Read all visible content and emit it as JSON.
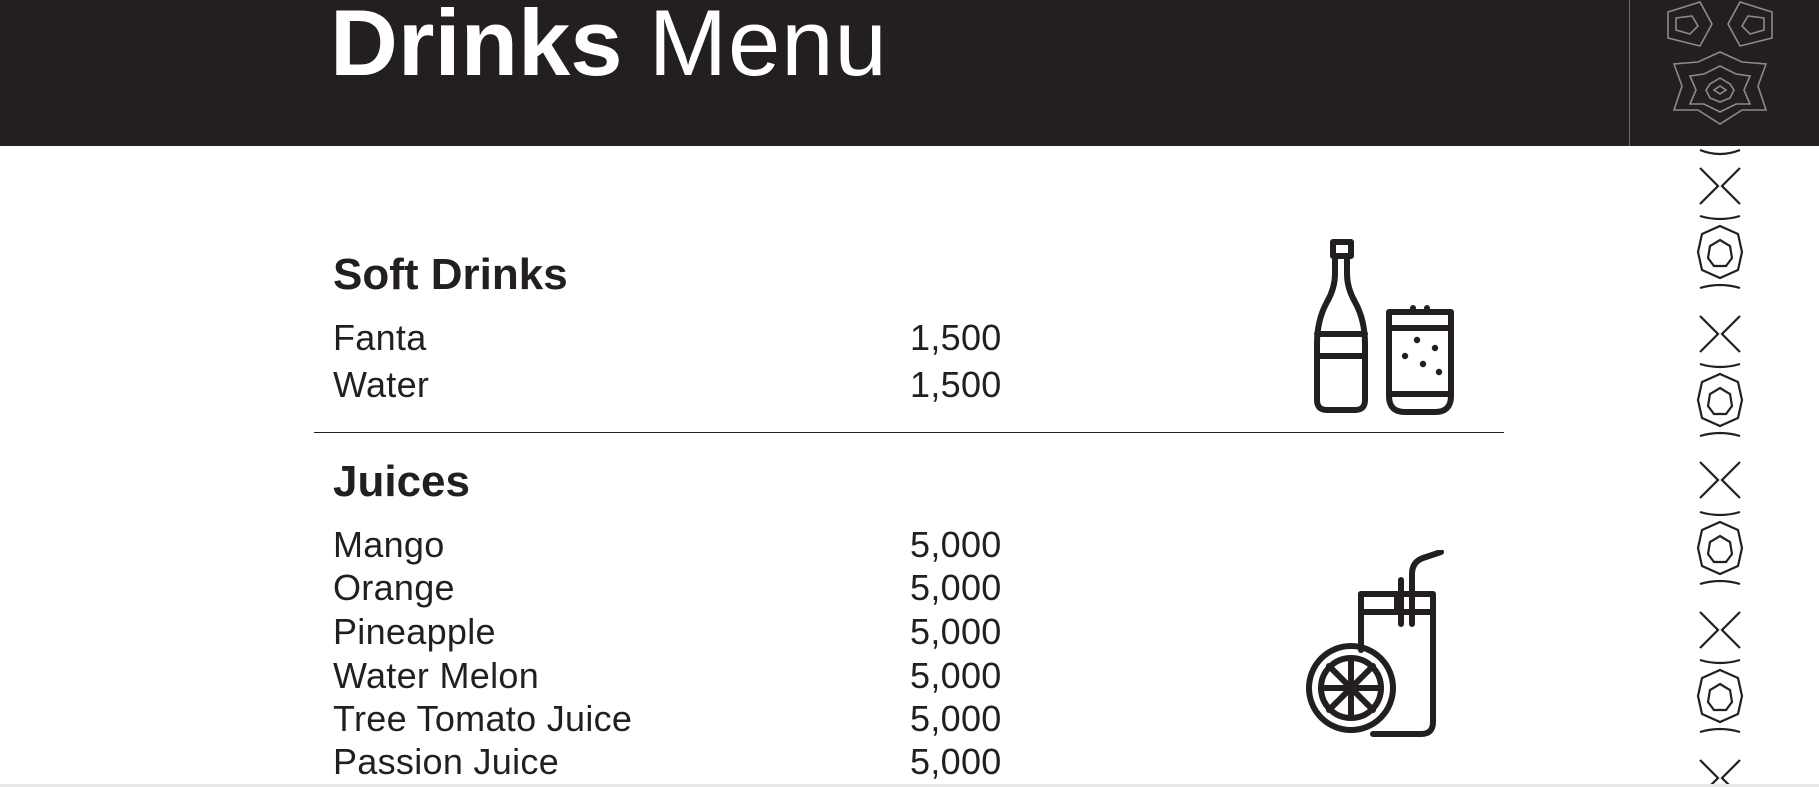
{
  "title": {
    "bold": "Drinks",
    "light": "Menu"
  },
  "sections": {
    "soft_drinks": {
      "heading": "Soft Drinks",
      "items": [
        {
          "name": "Fanta",
          "price": "1,500"
        },
        {
          "name": "Water",
          "price": "1,500"
        }
      ]
    },
    "juices": {
      "heading": "Juices",
      "items": [
        {
          "name": "Mango",
          "price": "5,000"
        },
        {
          "name": "Orange",
          "price": "5,000"
        },
        {
          "name": "Pineapple",
          "price": "5,000"
        },
        {
          "name": "Water Melon",
          "price": "5,000"
        },
        {
          "name": "Tree Tomato Juice",
          "price": "5,000"
        },
        {
          "name": "Passion Juice",
          "price": "5,000"
        }
      ]
    }
  },
  "icons": {
    "soft_drinks": "bottle-and-glass-icon",
    "juices": "juice-glass-and-orange-icon",
    "pattern": "geometric-pattern"
  },
  "colors": {
    "ink": "#231f20",
    "background": "#ffffff",
    "header_text": "#ffffff"
  }
}
